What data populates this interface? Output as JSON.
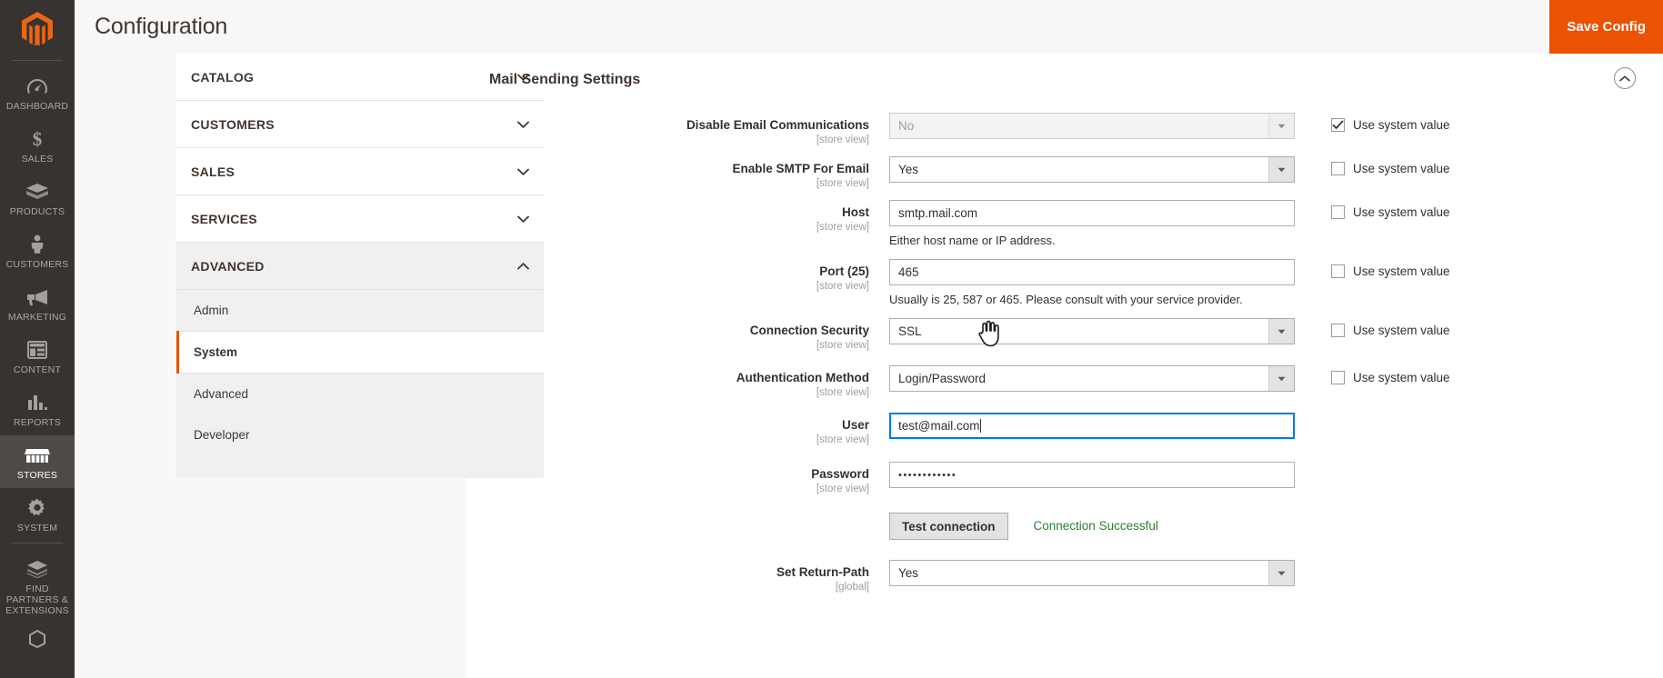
{
  "colors": {
    "brand_orange": "#eb5202",
    "sidebar_bg": "#373330",
    "success_green": "#2e7d32",
    "focus_blue": "#007bdb"
  },
  "sidebar": {
    "logo_name": "magento-logo-icon",
    "items": [
      {
        "label": "DASHBOARD",
        "icon": "dashboard-icon",
        "active": false
      },
      {
        "label": "SALES",
        "icon": "dollar-icon",
        "active": false
      },
      {
        "label": "PRODUCTS",
        "icon": "box-icon",
        "active": false
      },
      {
        "label": "CUSTOMERS",
        "icon": "person-icon",
        "active": false
      },
      {
        "label": "MARKETING",
        "icon": "megaphone-icon",
        "active": false
      },
      {
        "label": "CONTENT",
        "icon": "layout-icon",
        "active": false
      },
      {
        "label": "REPORTS",
        "icon": "bar-chart-icon",
        "active": false
      },
      {
        "label": "STORES",
        "icon": "store-icon",
        "active": true
      },
      {
        "label": "SYSTEM",
        "icon": "gear-icon",
        "active": false
      },
      {
        "label": "FIND PARTNERS & EXTENSIONS",
        "icon": "extensions-icon",
        "active": false
      }
    ]
  },
  "header": {
    "title": "Configuration",
    "save_label": "Save Config"
  },
  "config_nav": {
    "sections": [
      {
        "label": "CATALOG",
        "expanded": false,
        "chevron": "chevron-down-icon"
      },
      {
        "label": "CUSTOMERS",
        "expanded": false,
        "chevron": "chevron-down-icon"
      },
      {
        "label": "SALES",
        "expanded": false,
        "chevron": "chevron-down-icon"
      },
      {
        "label": "SERVICES",
        "expanded": false,
        "chevron": "chevron-down-icon"
      },
      {
        "label": "ADVANCED",
        "expanded": true,
        "chevron": "chevron-up-icon"
      }
    ],
    "advanced_items": [
      {
        "label": "Admin",
        "active": false
      },
      {
        "label": "System",
        "active": true
      },
      {
        "label": "Advanced",
        "active": false
      },
      {
        "label": "Developer",
        "active": false
      }
    ]
  },
  "main": {
    "section_title": "Mail Sending Settings",
    "collapse_icon": "chevron-up-icon",
    "use_system_value_label": "Use system value",
    "rows": [
      {
        "label": "Disable Email Communications",
        "scope": "[store view]",
        "type": "select",
        "value": "No",
        "disabled": true,
        "use_system_value": true,
        "hint": ""
      },
      {
        "label": "Enable SMTP For Email",
        "scope": "[store view]",
        "type": "select",
        "value": "Yes",
        "disabled": false,
        "use_system_value": false,
        "hint": ""
      },
      {
        "label": "Host",
        "scope": "[store view]",
        "type": "text",
        "value": "smtp.mail.com",
        "disabled": false,
        "use_system_value": false,
        "hint": "Either host name or IP address."
      },
      {
        "label": "Port (25)",
        "scope": "[store view]",
        "type": "text",
        "value": "465",
        "disabled": false,
        "use_system_value": false,
        "hint": "Usually is 25, 587 or 465. Please consult with your service provider."
      },
      {
        "label": "Connection Security",
        "scope": "[store view]",
        "type": "select",
        "value": "SSL",
        "disabled": false,
        "use_system_value": false,
        "hint": ""
      },
      {
        "label": "Authentication Method",
        "scope": "[store view]",
        "type": "select",
        "value": "Login/Password",
        "disabled": false,
        "use_system_value": false,
        "hint": ""
      },
      {
        "label": "User",
        "scope": "[store view]",
        "type": "text",
        "value": "test@mail.com",
        "focused": true,
        "disabled": false,
        "use_system_value": false,
        "hint": ""
      },
      {
        "label": "Password",
        "scope": "[store view]",
        "type": "password",
        "value": "••••••••••••",
        "disabled": false,
        "use_system_value": false,
        "hint": ""
      }
    ],
    "test_connection": {
      "button_label": "Test connection",
      "status_text": "Connection Successful"
    },
    "return_path": {
      "label": "Set Return-Path",
      "scope": "[global]",
      "value": "Yes"
    }
  },
  "cursor": {
    "type": "hand-cursor"
  }
}
